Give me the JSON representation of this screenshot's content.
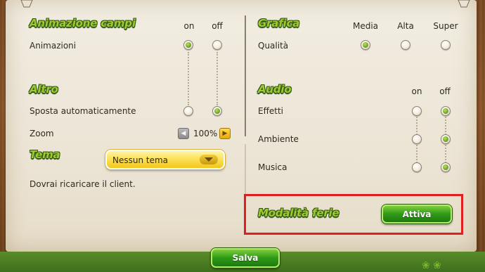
{
  "left": {
    "animazione_title": "Animazione campi",
    "col_on": "on",
    "col_off": "off",
    "animazioni_label": "Animazioni",
    "altro_title": "Altro",
    "sposta_label": "Sposta automaticamente",
    "zoom_label": "Zoom",
    "zoom_value": "100%",
    "tema_title": "Tema",
    "tema_selected": "Nessun tema",
    "ricaricare_note": "Dovrai ricaricare il client."
  },
  "right": {
    "grafica_title": "Grafica",
    "col_media": "Media",
    "col_alta": "Alta",
    "col_super": "Super",
    "qualita_label": "Qualità",
    "audio_title": "Audio",
    "col_on": "on",
    "col_off": "off",
    "effetti_label": "Effetti",
    "ambiente_label": "Ambiente",
    "musica_label": "Musica",
    "ferie_title": "Modalità ferie",
    "attiva_label": "Attiva"
  },
  "footer": {
    "salva_label": "Salva"
  },
  "state": {
    "animazioni": "on",
    "sposta_automaticamente": "off",
    "qualita": "Media",
    "effetti": "off",
    "ambiente": "off",
    "musica": "off"
  },
  "colors": {
    "section_title": "#a4c832",
    "button_green": "#2f9a18",
    "dropdown_yellow": "#fde25a",
    "highlight_red": "#e02020"
  }
}
